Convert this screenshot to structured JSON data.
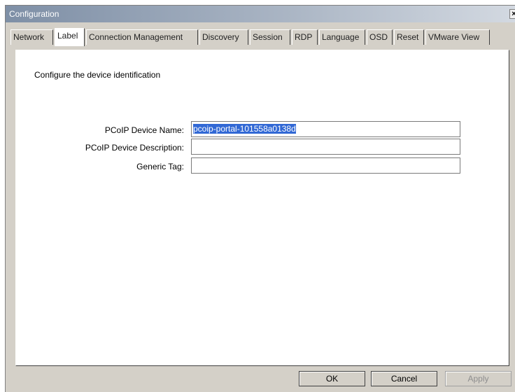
{
  "window": {
    "title": "Configuration",
    "close_glyph": "×",
    "close_icon": "close-icon"
  },
  "tabs": [
    {
      "label": "Network",
      "active": false
    },
    {
      "label": "Label",
      "active": true
    },
    {
      "label": "Connection Management",
      "active": false
    },
    {
      "label": "Discovery",
      "active": false
    },
    {
      "label": "Session",
      "active": false
    },
    {
      "label": "RDP",
      "active": false
    },
    {
      "label": "Language",
      "active": false
    },
    {
      "label": "OSD",
      "active": false
    },
    {
      "label": "Reset",
      "active": false
    },
    {
      "label": "VMware View",
      "active": false
    }
  ],
  "panel": {
    "heading": "Configure the device identification",
    "fields": {
      "device_name": {
        "label": "PCoIP Device Name:",
        "value": "pcoip-portal-101558a0138d",
        "selected": true
      },
      "device_description": {
        "label": "PCoIP Device Description:",
        "value": ""
      },
      "generic_tag": {
        "label": "Generic Tag:",
        "value": ""
      }
    }
  },
  "buttons": {
    "ok": "OK",
    "cancel": "Cancel",
    "apply": "Apply",
    "apply_enabled": false
  },
  "colors": {
    "title_gradient_start": "#7e8fa6",
    "selection": "#3168d5",
    "dialog_bg": "#d4d0c8"
  }
}
